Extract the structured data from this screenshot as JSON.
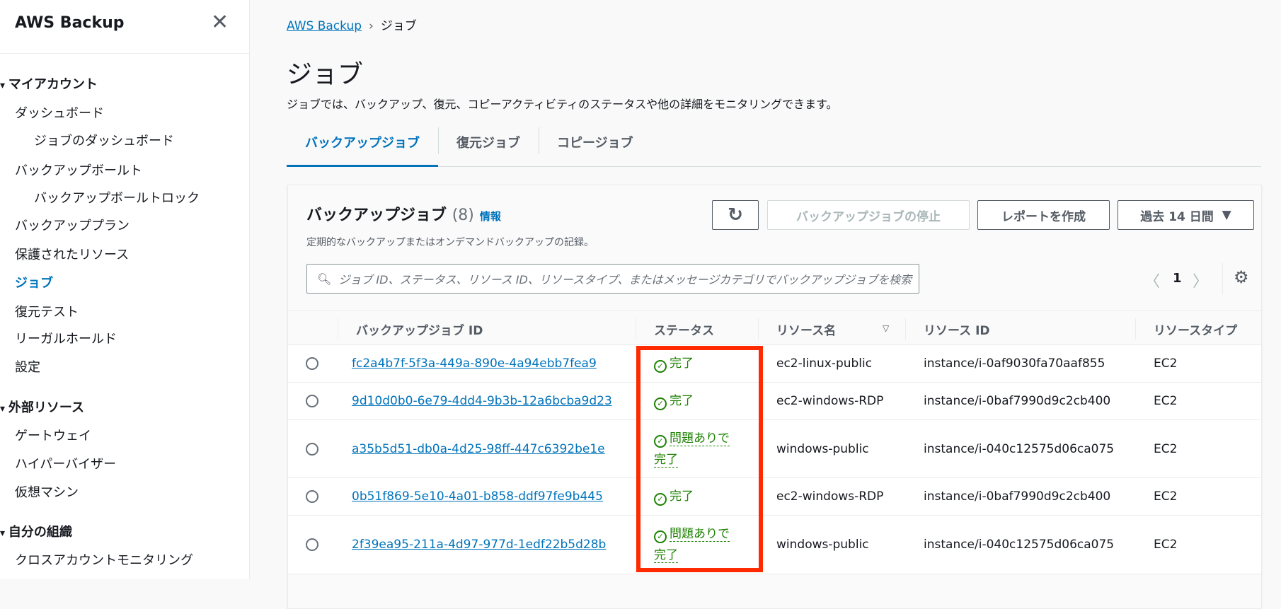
{
  "sidebar": {
    "title": "AWS Backup",
    "items": [
      {
        "label": "マイアカウント",
        "type": "section"
      },
      {
        "label": "ダッシュボード",
        "type": "item"
      },
      {
        "label": "ジョブのダッシュボード",
        "type": "sub"
      },
      {
        "label": "バックアップボールト",
        "type": "item"
      },
      {
        "label": "バックアップボールトロック",
        "type": "sub"
      },
      {
        "label": "バックアッププラン",
        "type": "item"
      },
      {
        "label": "保護されたリソース",
        "type": "item"
      },
      {
        "label": "ジョブ",
        "type": "active"
      },
      {
        "label": "復元テスト",
        "type": "item"
      },
      {
        "label": "リーガルホールド",
        "type": "item"
      },
      {
        "label": "設定",
        "type": "item"
      },
      {
        "label": "外部リソース",
        "type": "section"
      },
      {
        "label": "ゲートウェイ",
        "type": "item"
      },
      {
        "label": "ハイパーバイザー",
        "type": "item"
      },
      {
        "label": "仮想マシン",
        "type": "item"
      },
      {
        "label": "自分の組織",
        "type": "section"
      },
      {
        "label": "クロスアカウントモニタリング",
        "type": "item"
      }
    ]
  },
  "breadcrumb": {
    "root": "AWS Backup",
    "current": "ジョブ"
  },
  "page": {
    "title": "ジョブ",
    "description": "ジョブでは、バックアップ、復元、コピーアクティビティのステータスや他の詳細をモニタリングできます。"
  },
  "tabs": [
    "バックアップジョブ",
    "復元ジョブ",
    "コピージョブ"
  ],
  "panel": {
    "title": "バックアップジョブ",
    "count": "(8)",
    "info": "情報",
    "description": "定期的なバックアップまたはオンデマンドバックアップの記録。",
    "stop_button": "バックアップジョブの停止",
    "report_button": "レポートを作成",
    "range_select": "過去 14 日間",
    "search_placeholder": "ジョブ ID、ステータス、リソース ID、リソースタイプ、またはメッセージカテゴリでバックアップジョブを検索",
    "page": "1"
  },
  "table": {
    "columns": [
      "バックアップジョブ ID",
      "ステータス",
      "リソース名",
      "リソース ID",
      "リソースタイプ"
    ],
    "rows": [
      {
        "id": "fc2a4b7f-5f3a-449a-890e-4a94ebb7fea9",
        "status": "完了",
        "name": "ec2-linux-public",
        "resource_id": "instance/i-0af9030fa70aaf855",
        "type": "EC2"
      },
      {
        "id": "9d10d0b0-6e79-4dd4-9b3b-12a6bcba9d23",
        "status": "完了",
        "name": "ec2-windows-RDP",
        "resource_id": "instance/i-0baf7990d9c2cb400",
        "type": "EC2"
      },
      {
        "id": "a35b5d51-db0a-4d25-98ff-447c6392be1e",
        "status": "問題ありで完了",
        "name": "windows-public",
        "resource_id": "instance/i-040c12575d06ca075",
        "type": "EC2"
      },
      {
        "id": "0b51f869-5e10-4a01-b858-ddf97fe9b445",
        "status": "完了",
        "name": "ec2-windows-RDP",
        "resource_id": "instance/i-0baf7990d9c2cb400",
        "type": "EC2"
      },
      {
        "id": "2f39ea95-211a-4d97-977d-1edf22b5d28b",
        "status": "問題ありで完了",
        "name": "windows-public",
        "resource_id": "instance/i-040c12575d06ca075",
        "type": "EC2"
      }
    ]
  },
  "colors": {
    "link": "#0073bb",
    "success": "#1d8102",
    "highlight": "#ff2a00"
  }
}
